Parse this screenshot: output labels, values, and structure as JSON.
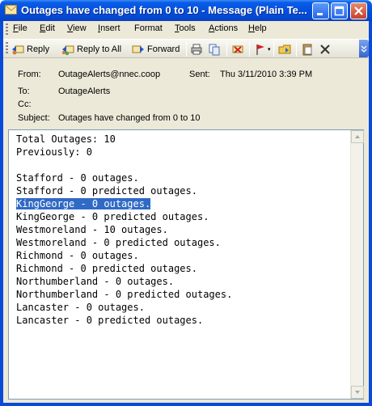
{
  "window": {
    "title": "Outages have changed from 0 to 10 - Message (Plain Te..."
  },
  "menu": {
    "items": [
      {
        "label": "File",
        "u": "F",
        "rest": "ile"
      },
      {
        "label": "Edit",
        "u": "E",
        "rest": "dit"
      },
      {
        "label": "View",
        "u": "V",
        "rest": "iew"
      },
      {
        "label": "Insert",
        "u": "I",
        "rest": "nsert"
      },
      {
        "label": "Format",
        "u": "",
        "rest": "Format"
      },
      {
        "label": "Tools",
        "u": "T",
        "rest": "ools"
      },
      {
        "label": "Actions",
        "u": "A",
        "rest": "ctions"
      },
      {
        "label": "Help",
        "u": "H",
        "rest": "elp"
      }
    ]
  },
  "toolbar": {
    "reply": "Reply",
    "reply_all": "Reply to All",
    "forward": "Forward"
  },
  "header": {
    "from_label": "From:",
    "from_value": "OutageAlerts@nnec.coop",
    "sent_label": "Sent:",
    "sent_value": "Thu 3/11/2010 3:39 PM",
    "to_label": "To:",
    "to_value": "OutageAlerts",
    "cc_label": "Cc:",
    "cc_value": "",
    "subject_label": "Subject:",
    "subject_value": "Outages have changed from 0 to 10"
  },
  "body": {
    "lines": [
      "Total Outages: 10",
      "Previously: 0",
      "",
      "Stafford - 0 outages.",
      "Stafford - 0 predicted outages.",
      "KingGeorge - 0 outages.",
      "KingGeorge - 0 predicted outages.",
      "Westmoreland - 10 outages.",
      "Westmoreland - 0 predicted outages.",
      "Richmond - 0 outages.",
      "Richmond - 0 predicted outages.",
      "Northumberland - 0 outages.",
      "Northumberland - 0 predicted outages.",
      "Lancaster - 0 outages.",
      "Lancaster - 0 predicted outages."
    ],
    "selected_line": 5
  },
  "colors": {
    "titlebar": "#0451dc",
    "selection": "#316ac5"
  }
}
